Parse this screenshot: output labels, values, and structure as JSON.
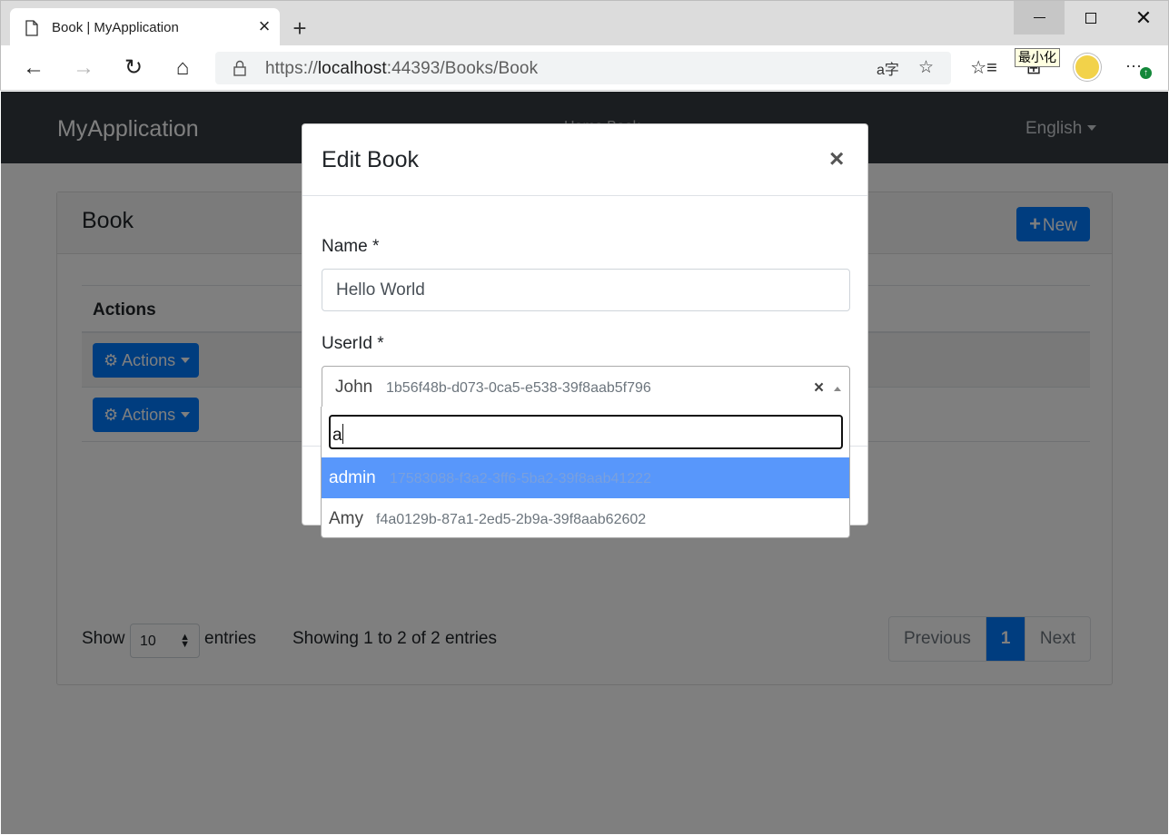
{
  "browser": {
    "tab_title": "Book | MyApplication",
    "url_prefix": "https://",
    "url_host": "localhost",
    "url_rest": ":44393/Books/Book",
    "tooltip": "最小化"
  },
  "navbar": {
    "brand": "MyApplication",
    "links": "Home   Book",
    "language": "English"
  },
  "card": {
    "title": "Book",
    "new_label": "New",
    "column_actions": "Actions",
    "rows": [
      {
        "actions_label": "Actions"
      },
      {
        "actions_label": "Actions"
      }
    ],
    "show_label": "Show",
    "page_length": "10",
    "entries_label": "entries",
    "info": "Showing 1 to 2 of 2 entries",
    "pagination": {
      "previous": "Previous",
      "current": "1",
      "next": "Next"
    }
  },
  "modal": {
    "title": "Edit Book",
    "close": "×",
    "name_label": "Name *",
    "name_value": "Hello World",
    "userid_label": "UserId *",
    "selected_user_name": "John",
    "selected_user_id": "1b56f48b-d073-0ca5-e538-39f8aab5f796",
    "clear": "×",
    "search_value": "a",
    "options": [
      {
        "name": "admin",
        "id": "17583088-f3a2-3ff6-5ba2-39f8aab41222",
        "highlighted": true
      },
      {
        "name": "Amy",
        "id": "f4a0129b-87a1-2ed5-2b9a-39f8aab62602",
        "highlighted": false
      }
    ]
  },
  "colors": {
    "primary": "#007bff",
    "navbar": "#343a40",
    "highlight": "#5897fb"
  }
}
